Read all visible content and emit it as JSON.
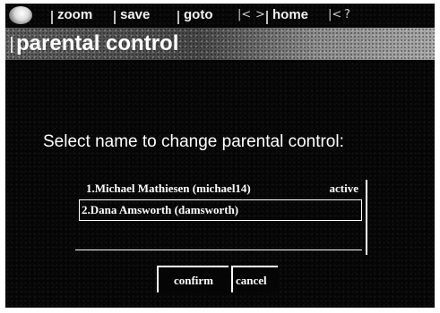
{
  "toolbar": {
    "logo_icon": "globe-logo-icon",
    "items": [
      {
        "label": "zoom"
      },
      {
        "label": "save"
      },
      {
        "label": "goto"
      },
      {
        "label": "home"
      }
    ],
    "back_glyph": "|<",
    "forward_glyph": ">",
    "end_glyph": "|<",
    "help_glyph": "?"
  },
  "title": {
    "text": "parental control"
  },
  "prompt": "Select name to change parental control:",
  "users": [
    {
      "label": "1.Michael Mathiesen (michael14)",
      "status": "active"
    },
    {
      "label": "2.Dana Amsworth (damsworth)",
      "status": ""
    }
  ],
  "buttons": {
    "confirm": "confirm",
    "cancel": "cancel"
  }
}
